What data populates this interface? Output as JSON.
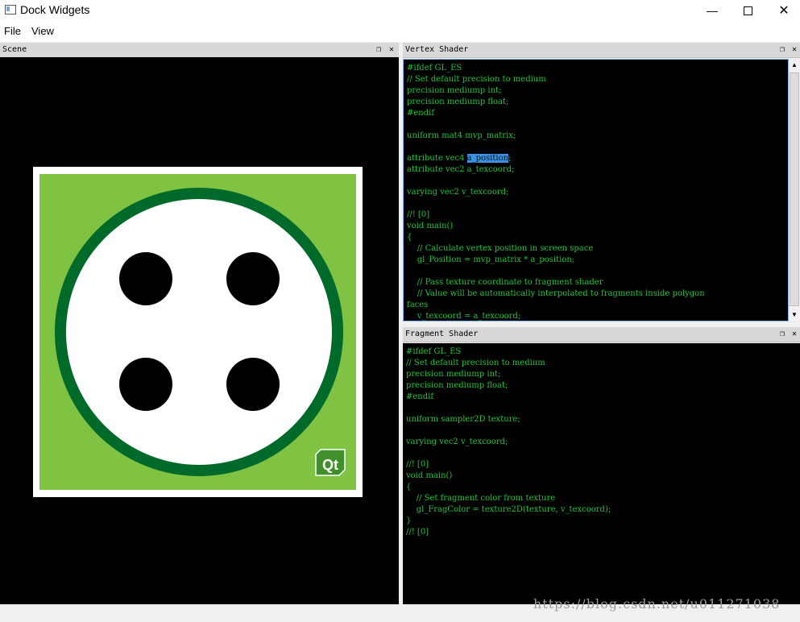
{
  "window": {
    "title": "Dock Widgets"
  },
  "menu": {
    "items": [
      "File",
      "View"
    ]
  },
  "docks": {
    "scene": {
      "title": "Scene"
    },
    "vertex": {
      "title": "Vertex Shader"
    },
    "fragment": {
      "title": "Fragment Shader"
    }
  },
  "vertex_code": {
    "before": "#ifdef GL_ES\n// Set default precision to medium\nprecision mediump int;\nprecision mediump float;\n#endif\n\nuniform mat4 mvp_matrix;\n\nattribute vec4 ",
    "selected": "a_position",
    "after": ";\nattribute vec2 a_texcoord;\n\nvarying vec2 v_texcoord;\n\n//! [0]\nvoid main()\n{\n    // Calculate vertex position in screen space\n    gl_Position = mvp_matrix * a_position;\n\n    // Pass texture coordinate to fragment shader\n    // Value will be automatically interpolated to fragments inside polygon\nfaces\n    v_texcoord = a_texcoord;"
  },
  "fragment_code": "#ifdef GL_ES\n// Set default precision to medium\nprecision mediump int;\nprecision mediump float;\n#endif\n\nuniform sampler2D texture;\n\nvarying vec2 v_texcoord;\n\n//! [0]\nvoid main()\n{\n    // Set fragment color from texture\n    gl_FragColor = texture2D(texture, v_texcoord);\n}\n//! [0]",
  "texture": {
    "logo_text": "Qt"
  },
  "watermark": "https://blog.csdn.net/u011271038",
  "colors": {
    "code": "#1ec63a",
    "selection": "#3d8fe8",
    "texture_green": "#80c342",
    "ring_green": "#006a2a"
  }
}
